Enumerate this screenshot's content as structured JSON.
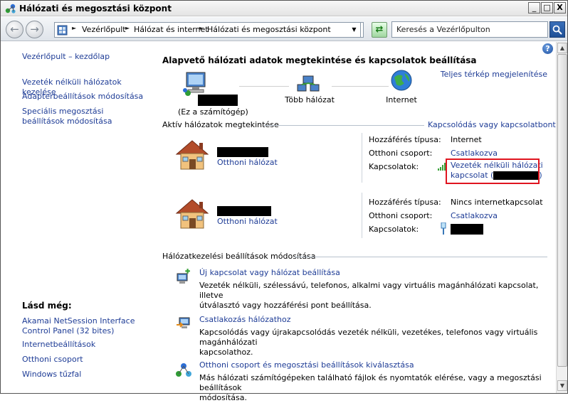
{
  "window": {
    "title": "Hálózati és megosztási központ",
    "controls": {
      "minimize": "_",
      "maximize": "□",
      "close": "X"
    }
  },
  "toolbar": {
    "breadcrumbs": [
      "Vezérlőpult",
      "Hálózat és internet",
      "Hálózati és megosztási központ"
    ],
    "search_placeholder": "Keresés a Vezérlőpulton"
  },
  "sidebar": {
    "links": [
      "Vezérlőpult – kezdőlap",
      "Vezeték nélküli hálózatok kezelése",
      "Adapterbeállítások módosítása",
      "Speciális megosztási beállítások módosítása"
    ],
    "see_also_title": "Lásd még:",
    "see_also": [
      "Akamai NetSession Interface Control Panel (32 bites)",
      "Internetbeállítások",
      "Otthoni csoport",
      "Windows tűzfal"
    ]
  },
  "main": {
    "title": "Alapvető hálózati adatok megtekintése és kapcsolatok beállítása",
    "full_map_link": "Teljes térkép megjelenítése",
    "map": {
      "computer_caption": "(Ez a számítógép)",
      "multiple_networks": "Több hálózat",
      "internet": "Internet"
    },
    "active_section": {
      "title": "Aktív hálózatok megtekintése",
      "connect_link": "Kapcsolódás vagy kapcsolatbontás"
    },
    "networks": [
      {
        "type_link": "Otthoni hálózat",
        "access_label": "Hozzáférés típusa:",
        "access_value": "Internet",
        "homegroup_label": "Otthoni csoport:",
        "homegroup_value": "Csatlakozva",
        "connections_label": "Kapcsolatok:",
        "connection_line1": "Vezeték nélküli hálózati",
        "connection_line2_prefix": "kapcsolat (",
        "connection_line2_suffix": ")"
      },
      {
        "type_link": "Otthoni hálózat",
        "access_label": "Hozzáférés típusa:",
        "access_value": "Nincs internetkapcsolat",
        "homegroup_label": "Otthoni csoport:",
        "homegroup_value": "Csatlakozva",
        "connections_label": "Kapcsolatok:"
      }
    ],
    "settings_section": {
      "title": "Hálózatkezelési beállítások módosítása"
    },
    "tasks": [
      {
        "title": "Új kapcsolat vagy hálózat beállítása",
        "desc_line1": "Vezeték nélküli, szélessávú, telefonos, alkalmi vagy virtuális magánhálózati kapcsolat, illetve",
        "desc_line2": "útválasztó vagy hozzáférési pont beállítása."
      },
      {
        "title": "Csatlakozás hálózathoz",
        "desc_line1": "Kapcsolódás vagy újrakapcsolódás vezeték nélküli, vezetékes, telefonos vagy virtuális magánhálózati",
        "desc_line2": "kapcsolathoz."
      },
      {
        "title": "Otthoni csoport és megosztási beállítások kiválasztása",
        "desc_line1": "Más hálózati számítógépeken található fájlok és nyomtatók elérése, vagy a megosztási beállítások",
        "desc_line2": "módosítása."
      }
    ]
  },
  "colors": {
    "link": "#1e3c96",
    "highlight": "#e0141f",
    "title_bar": "#e4e4e4"
  },
  "icons": [
    "network-app-icon",
    "back-icon",
    "forward-icon",
    "refresh-icon",
    "search-icon",
    "help-icon",
    "computer-icon",
    "multi-network-icon",
    "globe-icon",
    "house-icon",
    "wifi-signal-icon",
    "ethernet-icon",
    "new-connection-icon",
    "connect-network-icon",
    "homegroup-icon"
  ]
}
